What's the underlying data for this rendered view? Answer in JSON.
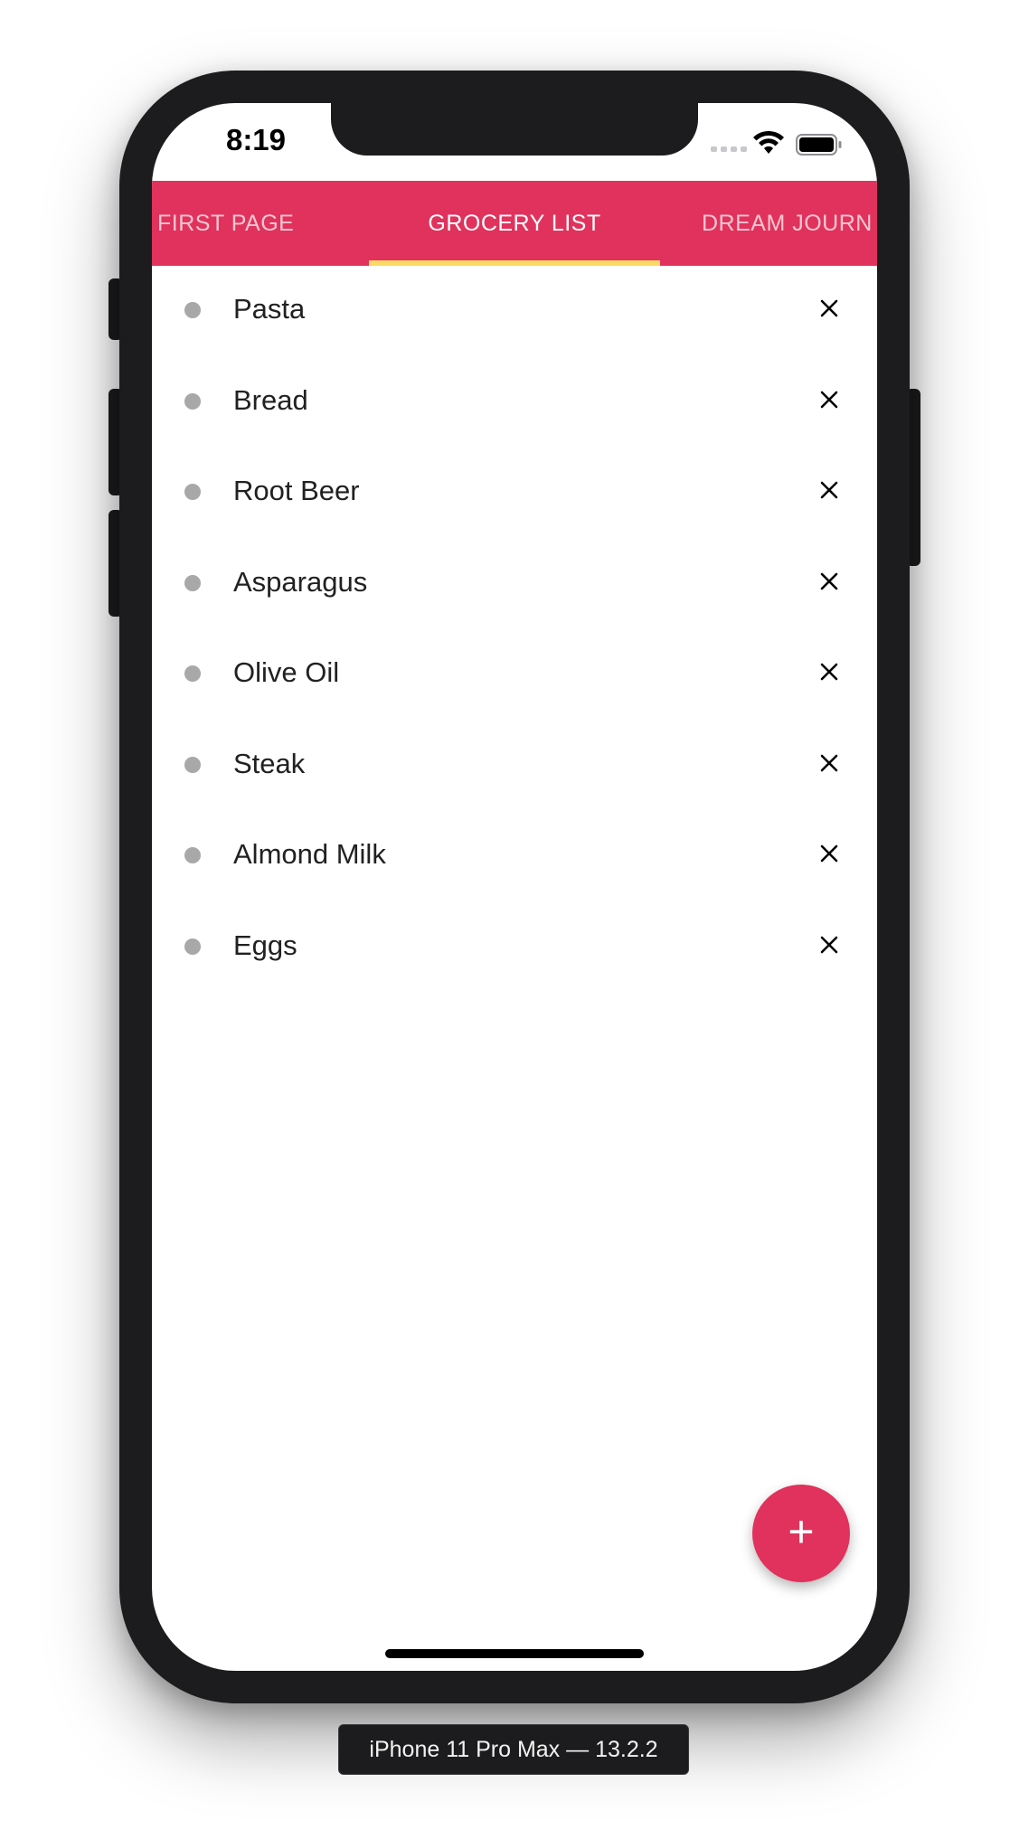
{
  "status_bar": {
    "time": "8:19",
    "wifi_icon": "wifi-icon",
    "battery_icon": "battery-icon",
    "signal_icon": "cellular-signal-icon"
  },
  "tabs": [
    {
      "label": "FIRST PAGE",
      "selected": false
    },
    {
      "label": "GROCERY LIST",
      "selected": true
    },
    {
      "label": "DREAM JOURN",
      "selected": false
    }
  ],
  "grocery_items": [
    {
      "label": "Pasta"
    },
    {
      "label": "Bread"
    },
    {
      "label": "Root Beer"
    },
    {
      "label": "Asparagus"
    },
    {
      "label": "Olive Oil"
    },
    {
      "label": "Steak"
    },
    {
      "label": "Almond Milk"
    },
    {
      "label": "Eggs"
    }
  ],
  "fab": {
    "label": "+"
  },
  "device_label": "iPhone 11 Pro Max — 13.2.2",
  "colors": {
    "accent": "#e0325c",
    "tab_indicator": "#fdd966",
    "bullet": "#a8a8a8",
    "text": "#212121"
  }
}
